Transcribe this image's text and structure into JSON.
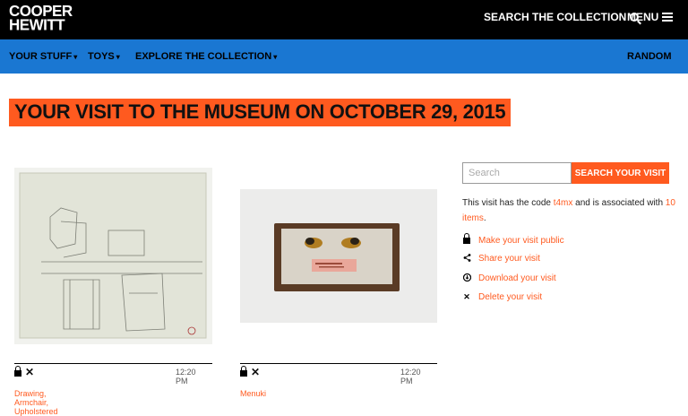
{
  "header": {
    "logo_line1": "COOPER",
    "logo_line2": "HEWITT",
    "search_collection": "SEARCH THE COLLECTION",
    "menu": "MENU"
  },
  "nav": {
    "items": [
      {
        "label": "YOUR STUFF"
      },
      {
        "label": "TOYS"
      },
      {
        "label": "EXPLORE THE COLLECTION"
      }
    ],
    "random": "RANDOM"
  },
  "page": {
    "title": "YOUR VISIT TO THE MUSEUM ON OCTOBER 29, 2015"
  },
  "items": [
    {
      "time": "12:20 PM",
      "caption": "Drawing, Armchair, Upholstered"
    },
    {
      "time": "12:20 PM",
      "caption": "Menuki"
    }
  ],
  "sidebar": {
    "search_placeholder": "Search",
    "search_button": "SEARCH YOUR VISIT",
    "visit_pre": "This visit has the code ",
    "visit_code": "t4mx",
    "visit_mid": " and is associated with ",
    "visit_items": "10 items",
    "visit_end": ".",
    "actions": [
      {
        "label": "Make your visit public",
        "icon": "lock-icon"
      },
      {
        "label": "Share your visit",
        "icon": "share-icon"
      },
      {
        "label": "Download your visit",
        "icon": "download-icon"
      },
      {
        "label": "Delete your visit",
        "icon": "close-icon"
      }
    ]
  },
  "colors": {
    "accent": "#ff5a1f",
    "nav_blue": "#1a77d2",
    "topbar": "#000000"
  }
}
